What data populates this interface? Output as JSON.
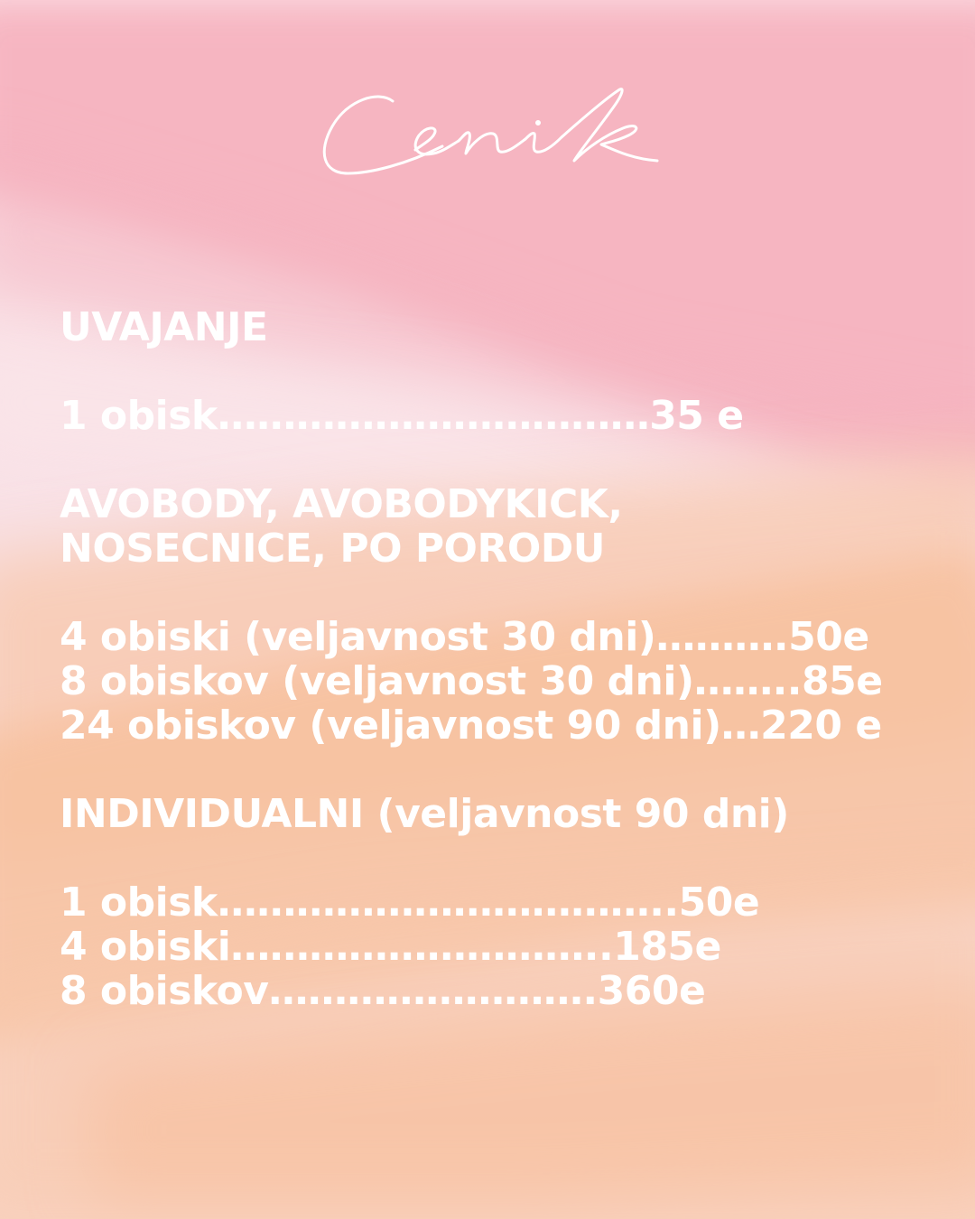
{
  "title": "Cenik",
  "colors": {
    "base_top": "#f9dde3",
    "base_bottom": "#f8d2c4",
    "pink_stroke": "#f5a8b6",
    "peach_stroke": "#f7c197",
    "text": "#ffffff"
  },
  "sections": {
    "uvajanje": {
      "heading": "UVAJANJE",
      "items": [
        "1 obisk……………………………35 e"
      ]
    },
    "avobody": {
      "heading_line1": "AVOBODY, AVOBODYKICK,",
      "heading_line2": "NOSECNICE, PO PORODU",
      "items": [
        "4 obiski (veljavnost 30 dni)……….50e",
        "8 obiskov (veljavnost 30 dni)……..85e",
        "24 obiskov (veljavnost 90 dni)…220 e"
      ]
    },
    "individualni": {
      "heading": "INDIVIDUALNI (veljavnost 90 dni)",
      "items": [
        "1 obisk……………………………..50e",
        "4 obiski………………………..185e",
        "8 obiskov…………………….360e"
      ]
    }
  }
}
